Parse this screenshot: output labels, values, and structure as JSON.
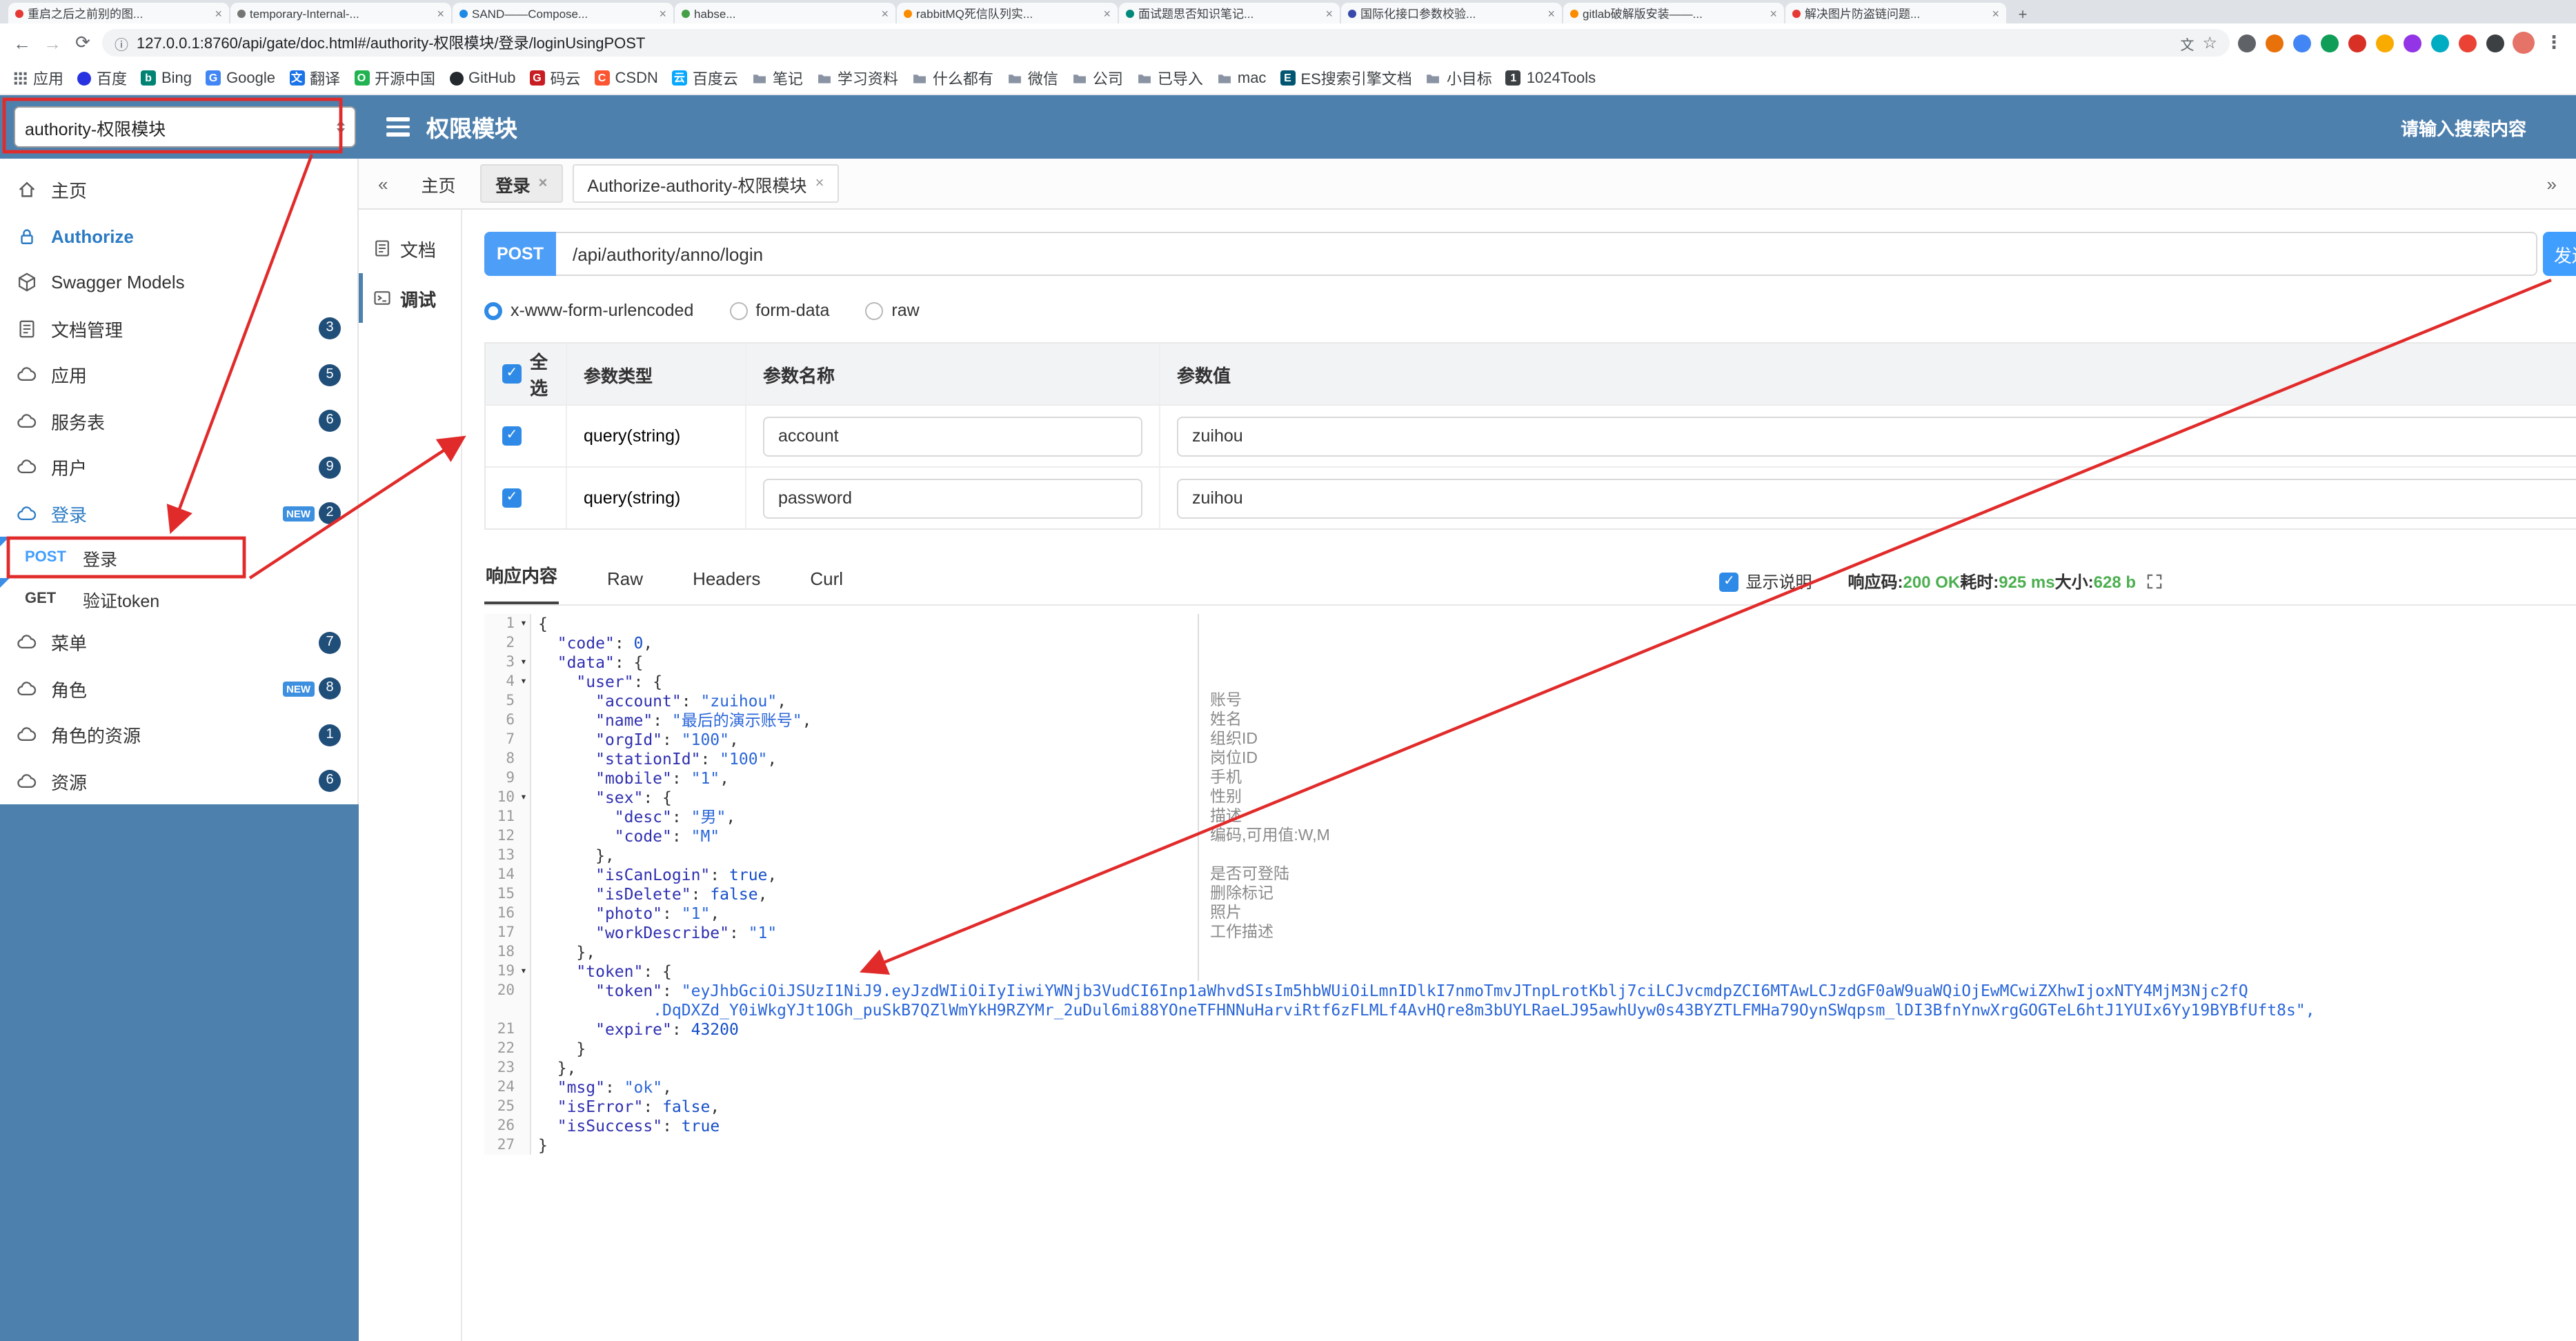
{
  "colors": {
    "header_blue": "#4e80ae",
    "annotation_red": "#e12b2b",
    "method_post_blue": "#409EFF",
    "success_green": "#4caf50",
    "badge_navy": "#1f4e79",
    "json_key_blue": "#2f2fb0",
    "json_string_blue": "#2a66d9"
  },
  "browser": {
    "tabs": [
      {
        "title": "重启之后之前别的图...",
        "color": "#e53935"
      },
      {
        "title": "temporary-Internal-...",
        "color": "#757575"
      },
      {
        "title": "SAND——Compose...",
        "color": "#1e88e5"
      },
      {
        "title": "habse...",
        "color": "#43a047"
      },
      {
        "title": "rabbitMQ死信队列实...",
        "color": "#fb8c00"
      },
      {
        "title": "面试题思否知识笔记...",
        "color": "#00897b"
      },
      {
        "title": "国际化接口参数校验...",
        "color": "#3949ab"
      },
      {
        "title": "gitlab破解版安装——...",
        "color": "#fb8c00"
      },
      {
        "title": "解决图片防盗链问题...",
        "color": "#e53935"
      }
    ],
    "new_tab_label": "+",
    "url": "127.0.0.1:8760/api/gate/doc.html#/authority-权限模块/登录/loginUsingPOST",
    "extension_colors": [
      "#5f6368",
      "#e8710a",
      "#4285f4",
      "#0f9d58",
      "#d93025",
      "#f9ab00",
      "#9334e6",
      "#00acc1",
      "#ea4335",
      "#3c4043"
    ],
    "bookmarks": [
      {
        "label": "应用",
        "icon": "grid"
      },
      {
        "label": "百度",
        "icon": "dot",
        "color": "#2932e1"
      },
      {
        "label": "Bing",
        "icon": "letter",
        "color": "#008373",
        "char": "b"
      },
      {
        "label": "Google",
        "icon": "letter",
        "color": "#4285f4",
        "char": "G"
      },
      {
        "label": "翻译",
        "icon": "letter",
        "color": "#1a73e8",
        "char": "文"
      },
      {
        "label": "开源中国",
        "icon": "letter",
        "color": "#21b351",
        "char": "O"
      },
      {
        "label": "GitHub",
        "icon": "dot",
        "color": "#24292e"
      },
      {
        "label": "码云",
        "icon": "letter",
        "color": "#c71d23",
        "char": "G"
      },
      {
        "label": "CSDN",
        "icon": "letter",
        "color": "#fc5531",
        "char": "C"
      },
      {
        "label": "百度云",
        "icon": "letter",
        "color": "#06a7ff",
        "char": "云"
      },
      {
        "label": "笔记",
        "icon": "folder"
      },
      {
        "label": "学习资料",
        "icon": "folder"
      },
      {
        "label": "什么都有",
        "icon": "folder"
      },
      {
        "label": "微信",
        "icon": "folder"
      },
      {
        "label": "公司",
        "icon": "folder"
      },
      {
        "label": "已导入",
        "icon": "folder"
      },
      {
        "label": "mac",
        "icon": "folder"
      },
      {
        "label": "ES搜索引擎文档",
        "icon": "letter",
        "color": "#005571",
        "char": "E"
      },
      {
        "label": "小目标",
        "icon": "folder"
      },
      {
        "label": "1024Tools",
        "icon": "letter",
        "color": "#3c4043",
        "char": "1"
      }
    ]
  },
  "header": {
    "module_select": "authority-权限模块",
    "title": "权限模块",
    "search_placeholder": "请输入搜索内容"
  },
  "sidebar": {
    "items": [
      {
        "type": "item",
        "key": "home",
        "icon": "home",
        "label": "主页"
      },
      {
        "type": "item",
        "key": "authorize",
        "icon": "lock",
        "label": "Authorize",
        "accent": true
      },
      {
        "type": "item",
        "key": "swagger-models",
        "icon": "cube",
        "label": "Swagger Models"
      },
      {
        "type": "item",
        "key": "doc-manage",
        "icon": "docfile",
        "label": "文档管理",
        "badge": "3"
      },
      {
        "type": "item",
        "key": "application",
        "icon": "cloud",
        "label": "应用",
        "badge": "5"
      },
      {
        "type": "item",
        "key": "service-table",
        "icon": "cloud",
        "label": "服务表",
        "badge": "6"
      },
      {
        "type": "item",
        "key": "user",
        "icon": "cloud",
        "label": "用户",
        "badge": "9"
      },
      {
        "type": "item",
        "key": "login",
        "icon": "cloud",
        "label": "登录",
        "badge": "2",
        "new": true,
        "active": true
      },
      {
        "type": "sub",
        "key": "post-login",
        "method": "POST",
        "label": "登录"
      },
      {
        "type": "sub",
        "key": "get-verify-token",
        "method": "GET",
        "label": "验证token"
      },
      {
        "type": "item",
        "key": "menu",
        "icon": "cloud",
        "label": "菜单",
        "badge": "7"
      },
      {
        "type": "item",
        "key": "role",
        "icon": "cloud",
        "label": "角色",
        "badge": "8",
        "new": true
      },
      {
        "type": "item",
        "key": "role-resource",
        "icon": "cloud",
        "label": "角色的资源",
        "badge": "1"
      },
      {
        "type": "item",
        "key": "resource",
        "icon": "cloud",
        "label": "资源",
        "badge": "6"
      }
    ]
  },
  "content_tabs": {
    "items": [
      {
        "key": "home",
        "label": "主页",
        "closable": false
      },
      {
        "key": "login",
        "label": "登录",
        "closable": true,
        "active": true
      },
      {
        "key": "authorize-module",
        "label": "Authorize-authority-权限模块",
        "closable": true
      }
    ]
  },
  "doc_nav": {
    "items": [
      {
        "key": "doc",
        "icon": "doc",
        "label": "文档"
      },
      {
        "key": "debug",
        "icon": "debug",
        "label": "调试",
        "active": true
      }
    ]
  },
  "debug": {
    "method": "POST",
    "url": "/api/authority/anno/login",
    "send_label": "发送",
    "content_types": [
      {
        "key": "x-www-form-urlencoded",
        "label": "x-www-form-urlencoded",
        "selected": true
      },
      {
        "key": "form-data",
        "label": "form-data",
        "selected": false
      },
      {
        "key": "raw",
        "label": "raw",
        "selected": false
      }
    ],
    "params_table": {
      "select_all_label": "全选",
      "headers": [
        "参数类型",
        "参数名称",
        "参数值"
      ],
      "rows": [
        {
          "checked": true,
          "type": "query(string)",
          "name": "account",
          "value": "zuihou"
        },
        {
          "checked": true,
          "type": "query(string)",
          "name": "password",
          "value": "zuihou"
        }
      ]
    },
    "response": {
      "tabs": [
        "响应内容",
        "Raw",
        "Headers",
        "Curl"
      ],
      "active_tab": "响应内容",
      "show_desc_label": "显示说明",
      "meta": [
        {
          "label": "响应码:",
          "value": "200 OK"
        },
        {
          "label": "耗时:",
          "value": "925 ms"
        },
        {
          "label": "大小:",
          "value": "628 b"
        }
      ]
    },
    "json_lines": [
      {
        "n": 1,
        "t": "{"
      },
      {
        "n": 2,
        "t": "  \"code\": 0,"
      },
      {
        "n": 3,
        "t": "  \"data\": {"
      },
      {
        "n": 4,
        "t": "    \"user\": {"
      },
      {
        "n": 5,
        "t": "      \"account\": \"zuihou\","
      },
      {
        "n": 6,
        "t": "      \"name\": \"最后的演示账号\","
      },
      {
        "n": 7,
        "t": "      \"orgId\": \"100\","
      },
      {
        "n": 8,
        "t": "      \"stationId\": \"100\","
      },
      {
        "n": 9,
        "t": "      \"mobile\": \"1\","
      },
      {
        "n": 10,
        "t": "      \"sex\": {"
      },
      {
        "n": 11,
        "t": "        \"desc\": \"男\","
      },
      {
        "n": 12,
        "t": "        \"code\": \"M\""
      },
      {
        "n": 13,
        "t": "      },"
      },
      {
        "n": 14,
        "t": "      \"isCanLogin\": true,"
      },
      {
        "n": 15,
        "t": "      \"isDelete\": false,"
      },
      {
        "n": 16,
        "t": "      \"photo\": \"1\","
      },
      {
        "n": 17,
        "t": "      \"workDescribe\": \"1\""
      },
      {
        "n": 18,
        "t": "    },"
      },
      {
        "n": 19,
        "t": "    \"token\": {"
      },
      {
        "n": 20,
        "t": "      \"token\": \"eyJhbGciOiJSUzI1NiJ9.eyJzdWIiOiIyIiwiYWNjb3VudCI6Inp1aWhvdSIsIm5hbWUiOiLmnIDlkI7nmoTmvJTnpLrotKblj7ciLCJvcmdpZCI6MTAwLCJzdGF0aW9uaWQiOjEwMCwiZXhwIjoxNTY4MjM3Njc2fQ"
      },
      {
        "n": null,
        "wrap": true,
        "t": "            .DqDXZd_Y0iWkgYJt1OGh_puSkB7QZlWmYkH9RZYMr_2uDul6mi88YOneTFHNNuHarviRtf6zFLMLf4AvHQre8m3bUYLRaeLJ95awhUyw0s43BYZTLFMHa79OynSWqpsm_lDI3BfnYnwXrgGOGTeL6htJ1YUIx6Yy19BYBfUft8s\","
      },
      {
        "n": 21,
        "t": "      \"expire\": 43200"
      },
      {
        "n": 22,
        "t": "    }"
      },
      {
        "n": 23,
        "t": "  },"
      },
      {
        "n": 24,
        "t": "  \"msg\": \"ok\","
      },
      {
        "n": 25,
        "t": "  \"isError\": false,"
      },
      {
        "n": 26,
        "t": "  \"isSuccess\": true"
      },
      {
        "n": 27,
        "t": "}"
      }
    ],
    "field_notes": [
      {
        "line": 5,
        "text": "账号"
      },
      {
        "line": 6,
        "text": "姓名"
      },
      {
        "line": 7,
        "text": "组织ID"
      },
      {
        "line": 8,
        "text": "岗位ID"
      },
      {
        "line": 9,
        "text": "手机"
      },
      {
        "line": 10,
        "text": "性别"
      },
      {
        "line": 11,
        "text": "描述"
      },
      {
        "line": 12,
        "text": "编码,可用值:W,M"
      },
      {
        "line": 14,
        "text": "是否可登陆"
      },
      {
        "line": 15,
        "text": "删除标记"
      },
      {
        "line": 16,
        "text": "照片"
      },
      {
        "line": 17,
        "text": "工作描述"
      }
    ]
  }
}
